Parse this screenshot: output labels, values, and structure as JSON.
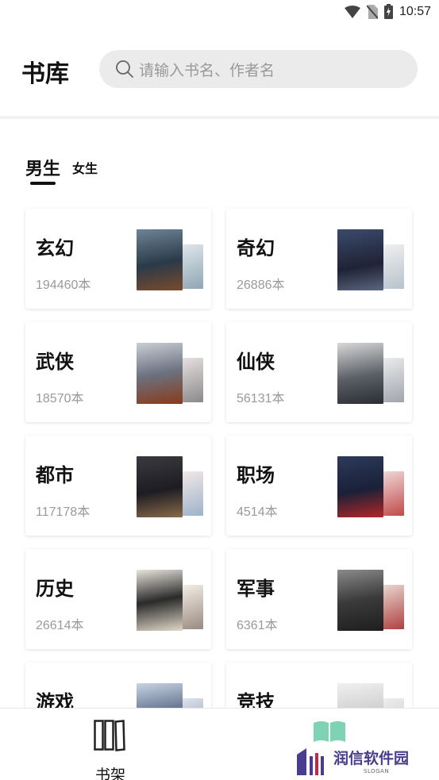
{
  "status_bar": {
    "time": "10:57"
  },
  "header": {
    "title": "书库",
    "search_placeholder": "请输入书名、作者名"
  },
  "tabs": [
    {
      "label": "男生",
      "selected": true
    },
    {
      "label": "女生",
      "selected": false
    }
  ],
  "categories": [
    {
      "name": "玄幻",
      "count": "194460本"
    },
    {
      "name": "奇幻",
      "count": "26886本"
    },
    {
      "name": "武侠",
      "count": "18570本"
    },
    {
      "name": "仙侠",
      "count": "56131本"
    },
    {
      "name": "都市",
      "count": "117178本"
    },
    {
      "name": "职场",
      "count": "4514本"
    },
    {
      "name": "历史",
      "count": "26614本"
    },
    {
      "name": "军事",
      "count": "6361本"
    },
    {
      "name": "游戏",
      "count": ""
    },
    {
      "name": "竞技",
      "count": ""
    }
  ],
  "bottom_nav": {
    "shelf_label": "书架",
    "shelf_icon": "bookshelf-icon",
    "library_icon": "open-book-icon",
    "library_icon_color": "#7dd3b4"
  },
  "watermark": {
    "text": "润信软件园",
    "sub": "SLOGAN"
  }
}
